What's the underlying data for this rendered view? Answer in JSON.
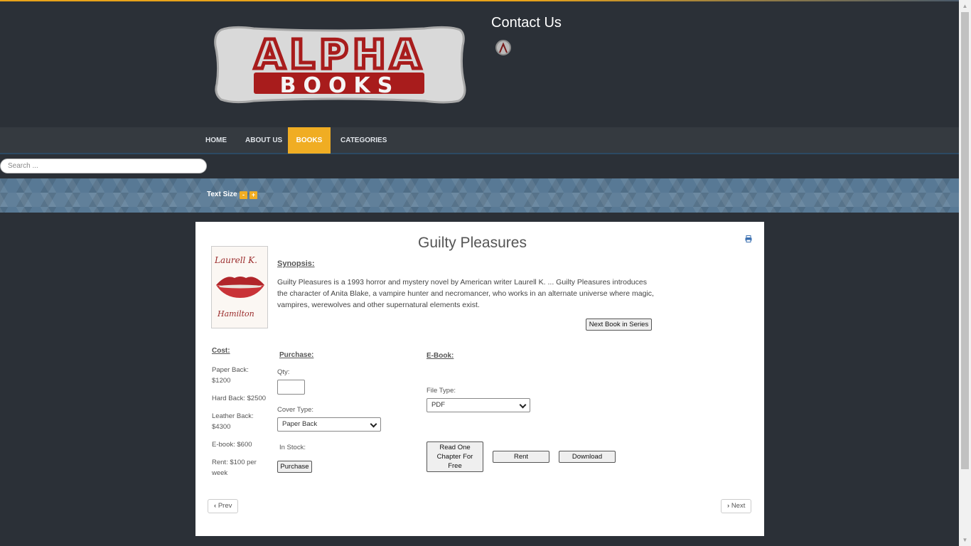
{
  "header": {
    "logo_text_top": "ALPHA",
    "logo_text_bottom": "BOOKS",
    "contact_title": "Contact Us"
  },
  "nav": {
    "items": [
      {
        "label": "HOME"
      },
      {
        "label": "ABOUT US"
      },
      {
        "label": "BOOKS",
        "active": true
      },
      {
        "label": "CATEGORIES"
      }
    ]
  },
  "search": {
    "placeholder": "Search ..."
  },
  "text_size": {
    "label": "Text Size",
    "minus": "-",
    "plus": "+"
  },
  "book": {
    "title": "Guilty Pleasures",
    "cover_author_top": "Laurell K.",
    "cover_author_bottom": "Hamilton",
    "synopsis_label": "Synopsis:",
    "synopsis": "Guilty Pleasures is a 1993 horror and mystery novel by American writer Laurell K. ... Guilty Pleasures introduces the character of Anita Blake, a vampire hunter and necromancer, who works in an alternate universe where magic, vampires, werewolves and other supernatural elements exist.",
    "next_in_series": "Next Book in Series"
  },
  "cost": {
    "label": "Cost:",
    "paper_back": "Paper Back: $1200",
    "hard_back": "Hard Back: $2500",
    "leather_back": "Leather Back: $4300",
    "ebook": "E-book: $600",
    "rent": "Rent: $100 per week"
  },
  "purchase": {
    "label": "Purchase:",
    "qty_label": "Qty:",
    "cover_type_label": "Cover Type:",
    "cover_type_value": "Paper Back",
    "in_stock_label": "In Stock:",
    "purchase_button": "Purchase"
  },
  "ebook": {
    "label": "E-Book:",
    "file_type_label": "File Type:",
    "file_type_value": "PDF",
    "read_chapter_button": "Read One Chapter For Free",
    "rent_button": "Rent",
    "download_button": "Download"
  },
  "pager": {
    "prev": "Prev",
    "next": "Next"
  },
  "colors": {
    "accent": "#f0ad23",
    "background": "#2b3037",
    "nav": "#353a40"
  }
}
